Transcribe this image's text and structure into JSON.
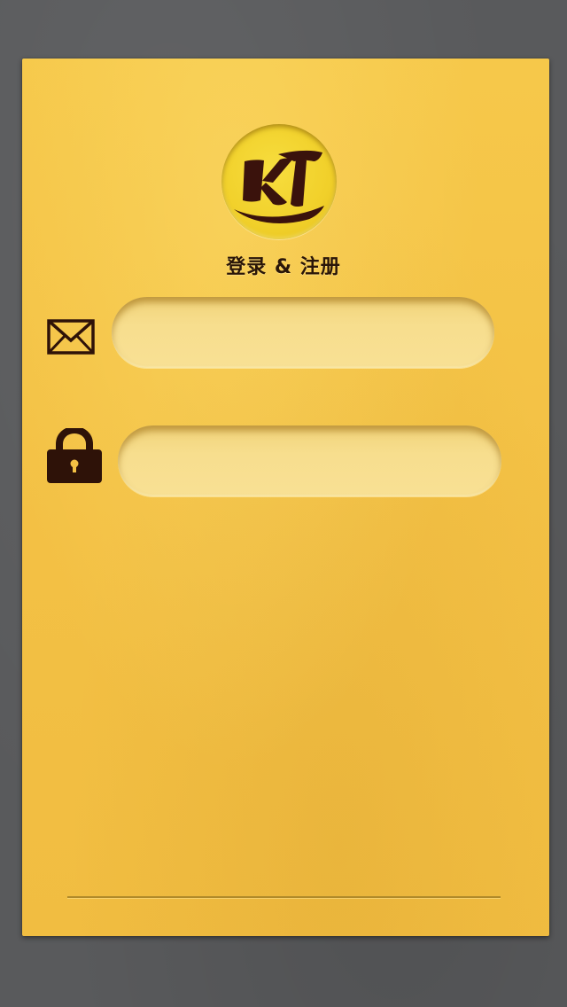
{
  "app": {
    "logo_text": "KT",
    "title": "登录 & 注册"
  },
  "form": {
    "email": {
      "icon": "mail-icon",
      "value": "",
      "placeholder": ""
    },
    "password": {
      "icon": "lock-icon",
      "value": "",
      "placeholder": ""
    }
  },
  "colors": {
    "background": "#595a5c",
    "card": "#f3c044",
    "logo_circle": "#f1d02a",
    "ink": "#2a1608"
  }
}
